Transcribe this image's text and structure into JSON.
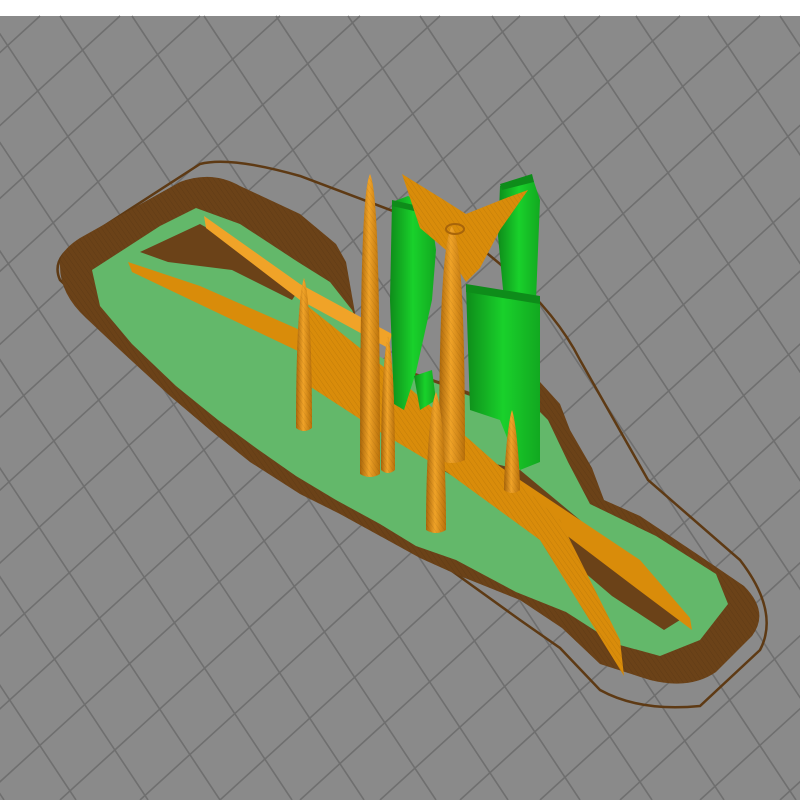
{
  "viewport": {
    "background": "#ffffff",
    "bed_color": "#8a8a8a",
    "grid_line_color": "#6f6f6f"
  },
  "preview": {
    "skirt_color": "#5e3a14",
    "brim_color": "#6b4218",
    "brim_dark_color": "#4a2c0c",
    "support_interface_color": "#63b86a",
    "support_color": "#19d12b",
    "support_dark_color": "#0e8c1a",
    "perimeter_color": "#d98c0a",
    "perimeter_dark_color": "#a8650a",
    "perimeter_light_color": "#f0a328"
  }
}
